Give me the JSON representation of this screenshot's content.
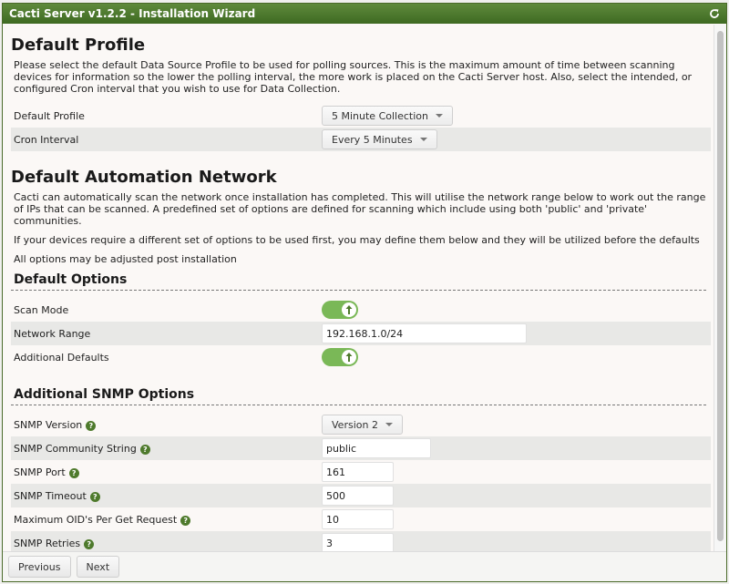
{
  "window": {
    "title": "Cacti Server v1.2.2 - Installation Wizard"
  },
  "default_profile": {
    "heading": "Default Profile",
    "description": "Please select the default Data Source Profile to be used for polling sources. This is the maximum amount of time between scanning devices for information so the lower the polling interval, the more work is placed on the Cacti Server host. Also, select the intended, or configured Cron interval that you wish to use for Data Collection.",
    "fields": [
      {
        "label": "Default Profile",
        "value": "5 Minute Collection"
      },
      {
        "label": "Cron Interval",
        "value": "Every 5 Minutes"
      }
    ]
  },
  "automation": {
    "heading": "Default Automation Network",
    "paragraphs": [
      "Cacti can automatically scan the network once installation has completed. This will utilise the network range below to work out the range of IPs that can be scanned. A predefined set of options are defined for scanning which include using both 'public' and 'private' communities.",
      "If your devices require a different set of options to be used first, you may define them below and they will be utilized before the defaults",
      "All options may be adjusted post installation"
    ]
  },
  "default_options": {
    "heading": "Default Options",
    "scan_mode": {
      "label": "Scan Mode",
      "enabled": true
    },
    "network_range": {
      "label": "Network Range",
      "value": "192.168.1.0/24"
    },
    "additional_defaults": {
      "label": "Additional Defaults",
      "enabled": true
    }
  },
  "snmp": {
    "heading": "Additional SNMP Options",
    "version": {
      "label": "SNMP Version",
      "value": "Version 2"
    },
    "community": {
      "label": "SNMP Community String",
      "value": "public"
    },
    "port": {
      "label": "SNMP Port",
      "value": "161"
    },
    "timeout": {
      "label": "SNMP Timeout",
      "value": "500"
    },
    "max_oids": {
      "label": "Maximum OID's Per Get Request",
      "value": "10"
    },
    "retries": {
      "label": "SNMP Retries",
      "value": "3"
    }
  },
  "footer": {
    "previous": "Previous",
    "next": "Next"
  },
  "colors": {
    "title_bar": "#4f7a2f",
    "toggle_on": "#7ab857",
    "help_icon": "#4e7a2c"
  },
  "icons": {
    "refresh": "refresh-icon",
    "help": "help-icon",
    "toggle": "toggle-switch"
  }
}
